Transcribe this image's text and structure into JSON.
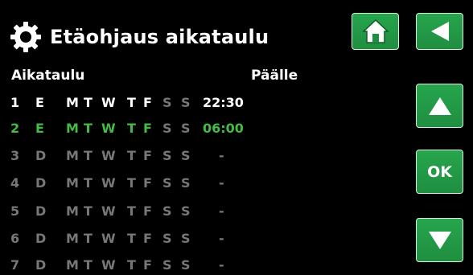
{
  "header": {
    "title": "Etäohjaus aikataulu",
    "icon": "gear-icon"
  },
  "columns": {
    "schedule": "Aikataulu",
    "on": "Päälle"
  },
  "rows": [
    {
      "num": "1",
      "mode": "E",
      "days": [
        "M",
        "T",
        "W",
        "T",
        "F",
        "S",
        "S"
      ],
      "time": "22:30",
      "state": "active"
    },
    {
      "num": "2",
      "mode": "E",
      "days": [
        "M",
        "T",
        "W",
        "T",
        "F",
        "S",
        "S"
      ],
      "time": "06:00",
      "state": "selected"
    },
    {
      "num": "3",
      "mode": "D",
      "days": [
        "M",
        "T",
        "W",
        "T",
        "F",
        "S",
        "S"
      ],
      "time": "-",
      "state": "inactive"
    },
    {
      "num": "4",
      "mode": "D",
      "days": [
        "M",
        "T",
        "W",
        "T",
        "F",
        "S",
        "S"
      ],
      "time": "-",
      "state": "inactive"
    },
    {
      "num": "5",
      "mode": "D",
      "days": [
        "M",
        "T",
        "W",
        "T",
        "F",
        "S",
        "S"
      ],
      "time": "-",
      "state": "inactive"
    },
    {
      "num": "6",
      "mode": "D",
      "days": [
        "M",
        "T",
        "W",
        "T",
        "F",
        "S",
        "S"
      ],
      "time": "-",
      "state": "inactive"
    },
    {
      "num": "7",
      "mode": "D",
      "days": [
        "M",
        "T",
        "W",
        "T",
        "F",
        "S",
        "S"
      ],
      "time": "-",
      "state": "inactive"
    }
  ],
  "buttons": {
    "home": "home-icon",
    "back": "back-arrow-icon",
    "up": "up-arrow-icon",
    "ok_label": "OK",
    "down": "down-arrow-icon"
  },
  "colors": {
    "background": "#000000",
    "button_green": "#23994a",
    "selected_text": "#44bb44",
    "inactive_text": "#777777"
  }
}
